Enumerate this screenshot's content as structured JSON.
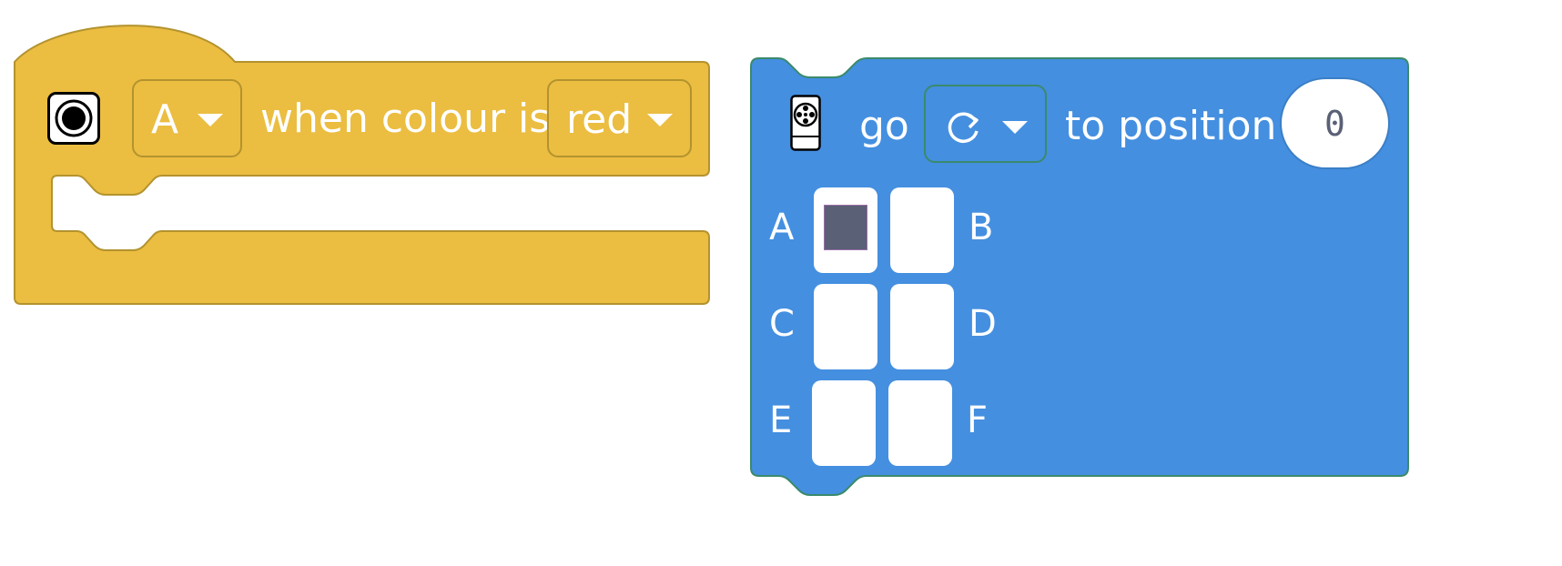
{
  "hat_block": {
    "icon": "color-sensor-icon",
    "port_dropdown": {
      "value": "A"
    },
    "label": "when colour is",
    "color_dropdown": {
      "value": "red"
    },
    "colors": {
      "fill": "#EBBD41",
      "stroke": "#B3932E"
    }
  },
  "motor_block": {
    "icon": "motor-icon",
    "go_label": "go",
    "direction_dropdown": {
      "icon": "clockwise-icon"
    },
    "position_label": "to position",
    "position_value": "0",
    "ports": [
      {
        "label": "A",
        "selected": true
      },
      {
        "label": "B",
        "selected": false
      },
      {
        "label": "C",
        "selected": false
      },
      {
        "label": "D",
        "selected": false
      },
      {
        "label": "E",
        "selected": false
      },
      {
        "label": "F",
        "selected": false
      }
    ],
    "colors": {
      "fill": "#448FE0",
      "stroke": "#3A8A6C",
      "selected_port": "#5A6075",
      "value_text": "#5A6075"
    }
  }
}
